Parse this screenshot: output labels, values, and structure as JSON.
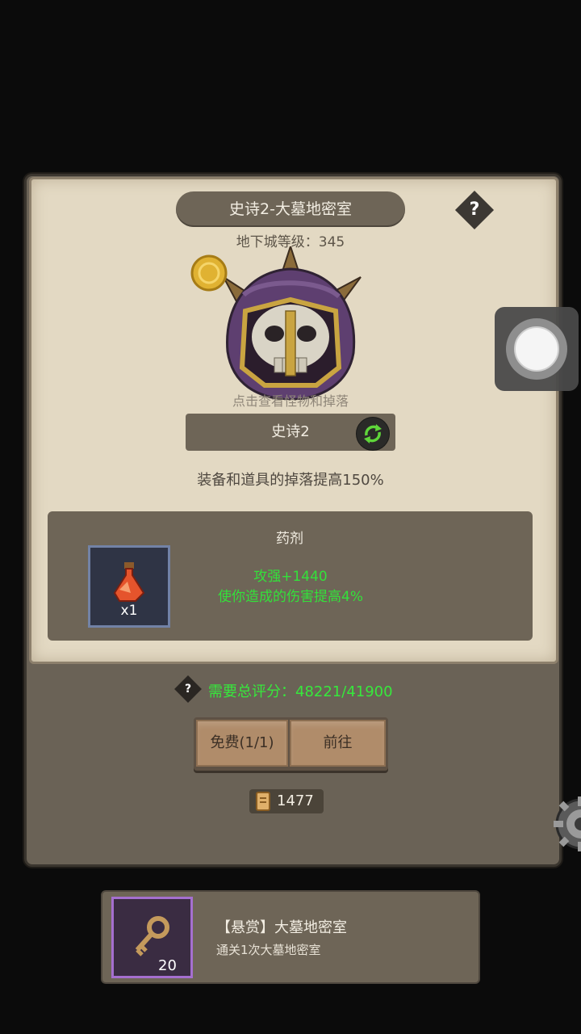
{
  "dungeon": {
    "title": "史诗2-大墓地密室",
    "help_icon": "?",
    "level_text": "地下城等级：345",
    "monster_hint": "点击查看怪物和掉落",
    "difficulty": "史诗2",
    "drop_bonus": "装备和道具的掉落提高150%"
  },
  "reward": {
    "title": "药剂",
    "item_icon": "red-potion-icon",
    "item_count": "x1",
    "effect_1": "攻强+1440",
    "effect_2": "使你造成的伤害提高4%"
  },
  "score": {
    "help_icon": "?",
    "text": "需要总评分：48221/41900"
  },
  "buttons": {
    "free": "免费(1/1)",
    "go": "前往"
  },
  "currency": {
    "icon": "scroll-icon",
    "count": "1477"
  },
  "quest": {
    "icon": "key-icon",
    "count": "20",
    "title": "【悬赏】大墓地密室",
    "subtitle": "通关1次大墓地密室"
  },
  "colors": {
    "green_text": "#33e13a",
    "panel": "#6e6557",
    "parchment": "#e3d9c3",
    "quest_frame": "#a56fcf",
    "item_frame": "#7282a6"
  }
}
